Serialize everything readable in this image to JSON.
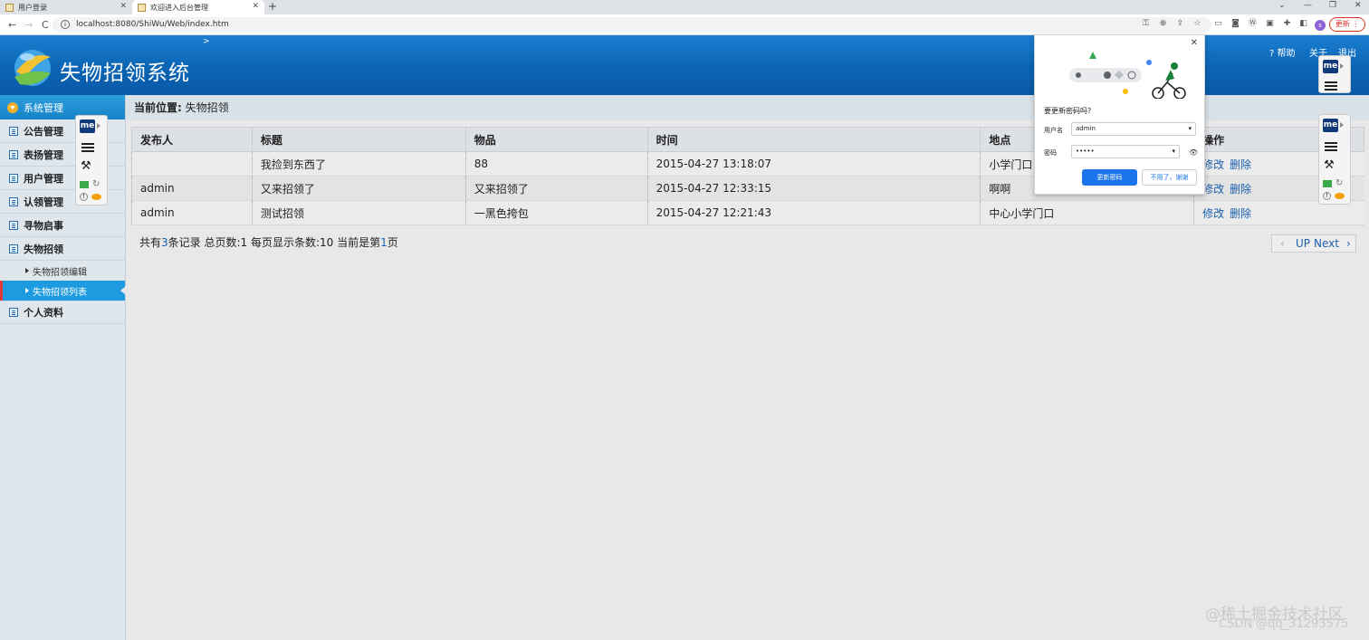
{
  "browser": {
    "tabs": [
      {
        "label": "用户登录",
        "close": "✕"
      },
      {
        "label": "欢迎进入后台管理",
        "close": "✕"
      }
    ],
    "new_tab": "+",
    "window_controls": [
      "⌄",
      "—",
      "❐",
      "✕"
    ],
    "nav": {
      "back": "←",
      "forward": "→",
      "reload": "C"
    },
    "url": "localhost:8080/ShiWu/Web/index.htm",
    "url_info": "i",
    "profile_initial": "s",
    "update_label": "更新 ⋮"
  },
  "header": {
    "title": "失物招领系统",
    "caret": ">",
    "help": "? 帮助",
    "about": "关于",
    "logout": "退出",
    "accent": "#0b64b4"
  },
  "sidebar": {
    "section": "系统管理",
    "items": [
      {
        "label": "公告管理"
      },
      {
        "label": "表扬管理"
      },
      {
        "label": "用户管理"
      },
      {
        "label": "认领管理"
      },
      {
        "label": "寻物启事"
      },
      {
        "label": "失物招领"
      }
    ],
    "sub_items": [
      {
        "label": "失物招领编辑",
        "active": false
      },
      {
        "label": "失物招领列表",
        "active": true
      }
    ],
    "last_item": "个人资料"
  },
  "breadcrumb": {
    "label": "当前位置:",
    "value": "失物招领"
  },
  "table": {
    "columns": [
      "发布人",
      "标题",
      "物品",
      "时间",
      "地点",
      "操作"
    ],
    "rows": [
      {
        "publisher": "",
        "title": "我捡到东西了",
        "item": "88",
        "time": "2015-04-27 13:18:07",
        "place": "小学门口",
        "edit": "修改",
        "delete": "删除"
      },
      {
        "publisher": "admin",
        "title": "又来招领了",
        "item": "又来招领了",
        "time": "2015-04-27 12:33:15",
        "place": "啊啊",
        "edit": "修改",
        "delete": "删除"
      },
      {
        "publisher": "admin",
        "title": "测试招领",
        "item": "一黑色挎包",
        "time": "2015-04-27 12:21:43",
        "place": "中心小学门口",
        "edit": "修改",
        "delete": "删除"
      }
    ]
  },
  "summary": {
    "p1": "共有",
    "total": "3",
    "p2": "条记录 总页数:1 每页显示条数:10 当前是第",
    "page": "1",
    "p3": "页"
  },
  "pager": {
    "prev": "‹",
    "up": "UP",
    "next": "Next",
    "next_arrow": "›"
  },
  "password_popup": {
    "close": "✕",
    "question": "要更新密码吗?",
    "username_label": "用户名",
    "username_value": "admin",
    "password_label": "密码",
    "password_value": "•••••",
    "dropdown": "▾",
    "eye": "👁",
    "update_button": "更新密码",
    "decline_button": "不用了，谢谢"
  },
  "extension": {
    "logo": "me",
    "wand": "⚒",
    "refresh": "↻",
    "warn": "!"
  },
  "watermark": {
    "line1": "@稀土掘金技术社区",
    "line2": "CSDN @qq_31293575"
  }
}
